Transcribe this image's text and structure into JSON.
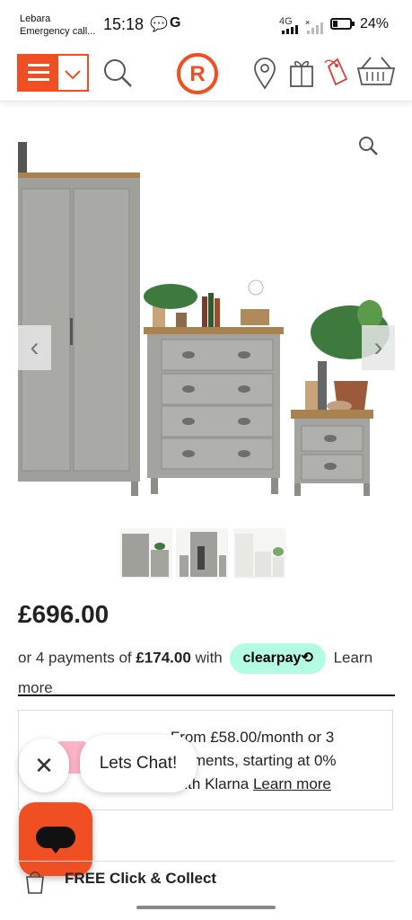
{
  "status_bar": {
    "carrier_line1": "Lebara",
    "carrier_line2": "Emergency call...",
    "time": "15:18",
    "network": "4G",
    "battery": "24%"
  },
  "header": {
    "logo_letter": "R"
  },
  "product": {
    "price": "£696.00",
    "clearpay": {
      "prefix": "or 4 payments of ",
      "amount": "£174.00",
      "with": " with ",
      "badge": "clearpay⟲",
      "learn_more": "Learn more"
    },
    "klarna": {
      "line1": "From £58.00/month or 3",
      "line2": "payments, starting at 0%",
      "line3": "with Klarna",
      "learn_more": "Learn more"
    }
  },
  "chat": {
    "close": "✕",
    "label": "Lets Chat!"
  },
  "delivery": {
    "collect_label": "FREE Click & Collect"
  },
  "colors": {
    "accent": "#f04e23",
    "clearpay": "#b2fce4",
    "furniture": "#9a9a98"
  }
}
